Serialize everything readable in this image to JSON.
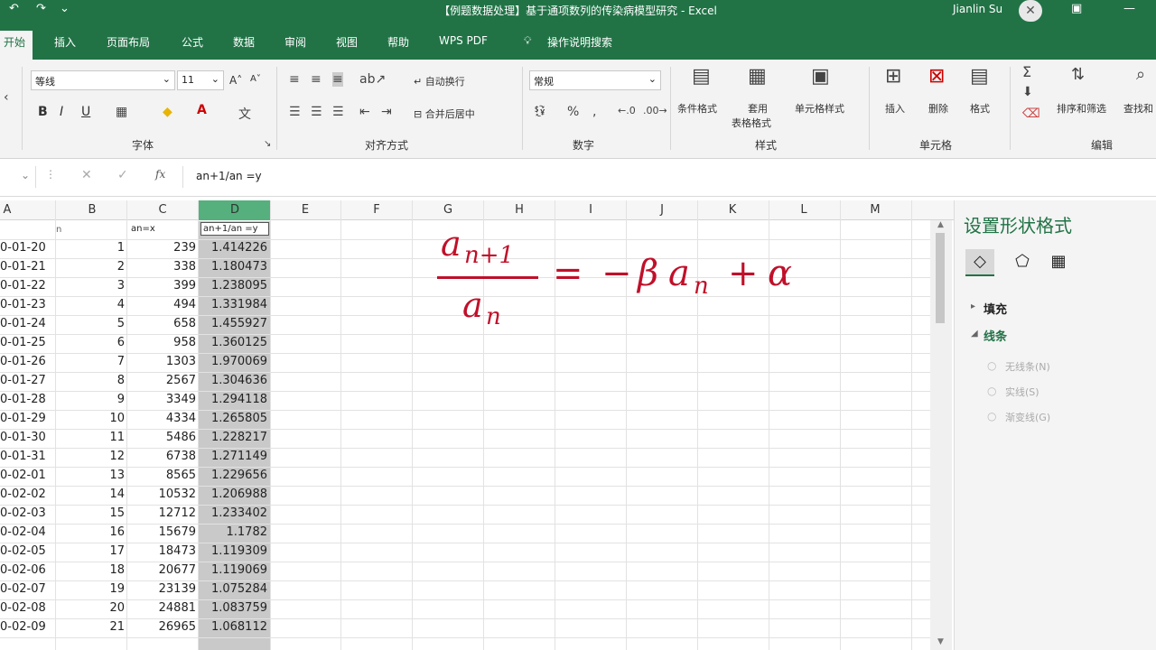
{
  "window": {
    "title": "【例题数据处理】基于通项数列的传染病模型研究 - Excel",
    "user": "Jianlin Su"
  },
  "tabs": [
    "开始",
    "插入",
    "页面布局",
    "公式",
    "数据",
    "审阅",
    "视图",
    "帮助",
    "WPS PDF",
    "操作说明搜索"
  ],
  "ribbon": {
    "font_name": "等线",
    "font_size": "11",
    "grow_font": "A˄",
    "shrink_font": "A˅",
    "bold": "B",
    "italic": "I",
    "underline": "U",
    "wrap_text": "自动换行",
    "merge_center": "合并后居中",
    "number_format": "常规",
    "cond_format": "条件格式",
    "table_format_1": "套用",
    "table_format_2": "表格格式",
    "cell_styles": "单元格样式",
    "insert": "插入",
    "delete": "删除",
    "format": "格式",
    "sort_filter": "排序和筛选",
    "find_select": "查找和",
    "groups": {
      "font": "字体",
      "alignment": "对齐方式",
      "number": "数字",
      "styles": "样式",
      "cells": "单元格",
      "editing": "编辑"
    }
  },
  "formula_bar": {
    "fx": "fx",
    "content": "an+1/an  =y"
  },
  "columns": [
    "A",
    "B",
    "C",
    "D",
    "E",
    "F",
    "G",
    "H",
    "I",
    "J",
    "K",
    "L",
    "M"
  ],
  "header_row": {
    "b": "n",
    "c": "an=x",
    "d": "an+1/an  =y"
  },
  "rows": [
    {
      "a": "0-01-20",
      "b": "1",
      "c": "239",
      "d": "1.414226"
    },
    {
      "a": "0-01-21",
      "b": "2",
      "c": "338",
      "d": "1.180473"
    },
    {
      "a": "0-01-22",
      "b": "3",
      "c": "399",
      "d": "1.238095"
    },
    {
      "a": "0-01-23",
      "b": "4",
      "c": "494",
      "d": "1.331984"
    },
    {
      "a": "0-01-24",
      "b": "5",
      "c": "658",
      "d": "1.455927"
    },
    {
      "a": "0-01-25",
      "b": "6",
      "c": "958",
      "d": "1.360125"
    },
    {
      "a": "0-01-26",
      "b": "7",
      "c": "1303",
      "d": "1.970069"
    },
    {
      "a": "0-01-27",
      "b": "8",
      "c": "2567",
      "d": "1.304636"
    },
    {
      "a": "0-01-28",
      "b": "9",
      "c": "3349",
      "d": "1.294118"
    },
    {
      "a": "0-01-29",
      "b": "10",
      "c": "4334",
      "d": "1.265805"
    },
    {
      "a": "0-01-30",
      "b": "11",
      "c": "5486",
      "d": "1.228217"
    },
    {
      "a": "0-01-31",
      "b": "12",
      "c": "6738",
      "d": "1.271149"
    },
    {
      "a": "0-02-01",
      "b": "13",
      "c": "8565",
      "d": "1.229656"
    },
    {
      "a": "0-02-02",
      "b": "14",
      "c": "10532",
      "d": "1.206988"
    },
    {
      "a": "0-02-03",
      "b": "15",
      "c": "12712",
      "d": "1.233402"
    },
    {
      "a": "0-02-04",
      "b": "16",
      "c": "15679",
      "d": "1.1782"
    },
    {
      "a": "0-02-05",
      "b": "17",
      "c": "18473",
      "d": "1.119309"
    },
    {
      "a": "0-02-06",
      "b": "18",
      "c": "20677",
      "d": "1.119069"
    },
    {
      "a": "0-02-07",
      "b": "19",
      "c": "23139",
      "d": "1.075284"
    },
    {
      "a": "0-02-08",
      "b": "20",
      "c": "24881",
      "d": "1.083759"
    },
    {
      "a": "0-02-09",
      "b": "21",
      "c": "26965",
      "d": "1.068112"
    }
  ],
  "formula_display": {
    "num": "a",
    "num_sub": "n+1",
    "den": "a",
    "den_sub": "n",
    "eq": "=",
    "rhs_minus": "−",
    "rhs_beta": "β",
    "rhs_a": "a",
    "rhs_sub": "n",
    "rhs_plus": "+",
    "rhs_alpha": "α"
  },
  "side_pane": {
    "title": "设置形状格式",
    "fill": "填充",
    "line": "线条",
    "opt1": "无线条(N)",
    "opt2": "实线(S)",
    "opt3": "渐变线(G)"
  },
  "colors": {
    "excel_green": "#217346",
    "formula_red": "#c0102a"
  }
}
